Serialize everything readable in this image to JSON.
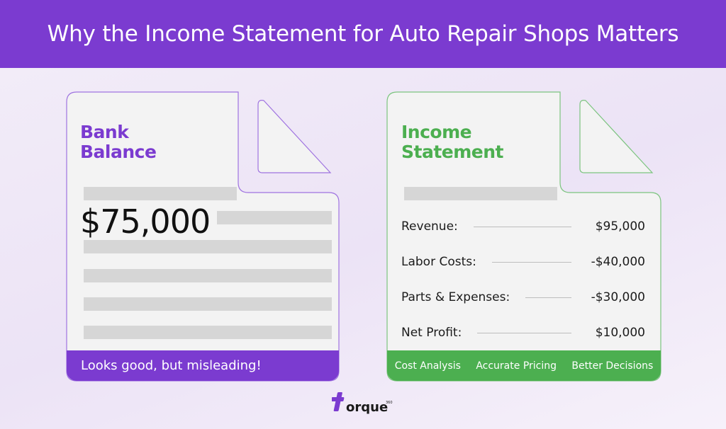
{
  "header": {
    "title": "Why the Income Statement for Auto Repair Shops Matters"
  },
  "bank": {
    "title_line1": "Bank",
    "title_line2": "Balance",
    "value": "$75,000",
    "footer": "Looks good, but misleading!",
    "accent": "#7b3bd0"
  },
  "income": {
    "title_line1": "Income",
    "title_line2": "Statement",
    "accent": "#4caf50",
    "rows": [
      {
        "label": "Revenue:",
        "value": "$95,000"
      },
      {
        "label": "Labor Costs:",
        "value": "-$40,000"
      },
      {
        "label": "Parts & Expenses:",
        "value": "-$30,000"
      },
      {
        "label": "Net Profit:",
        "value": "$10,000"
      }
    ],
    "footer_items": [
      "Cost Analysis",
      "Accurate Pricing",
      "Better Decisions"
    ]
  },
  "logo": {
    "text": "orque",
    "superscript": "360",
    "icon": "torque-cross-logo"
  }
}
